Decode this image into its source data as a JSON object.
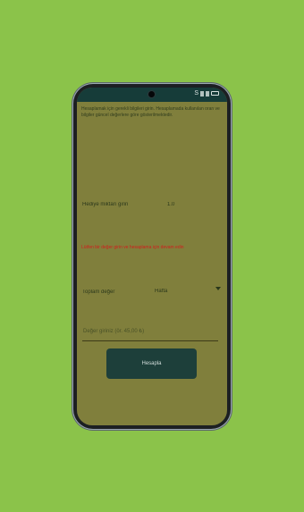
{
  "background": "#8bc34a",
  "status_bar": {
    "time": "",
    "icons_text": "S"
  },
  "intro": {
    "text": "Hesaplamak için gerekli bilgileri girin. Hesaplamada kullanılan oran ve bilgiler güncel değerlere göre gösterilmektedir."
  },
  "form": {
    "left_label": "Hediye miktarı girin",
    "value_right": "1.0",
    "error_text": "Lütfen bir değer girin ve hesaplama için devam edin",
    "dropdown_label": "Toplam değer",
    "dropdown_value": "Hafta",
    "input_placeholder": "Değer giriniz (ör. 45,00 ₺)",
    "button_label": "Hesapla"
  },
  "colors": {
    "screen_bg": "#807f3c",
    "statusbar": "#163c39",
    "button": "#1d3f3a",
    "error": "#d21c1c"
  }
}
